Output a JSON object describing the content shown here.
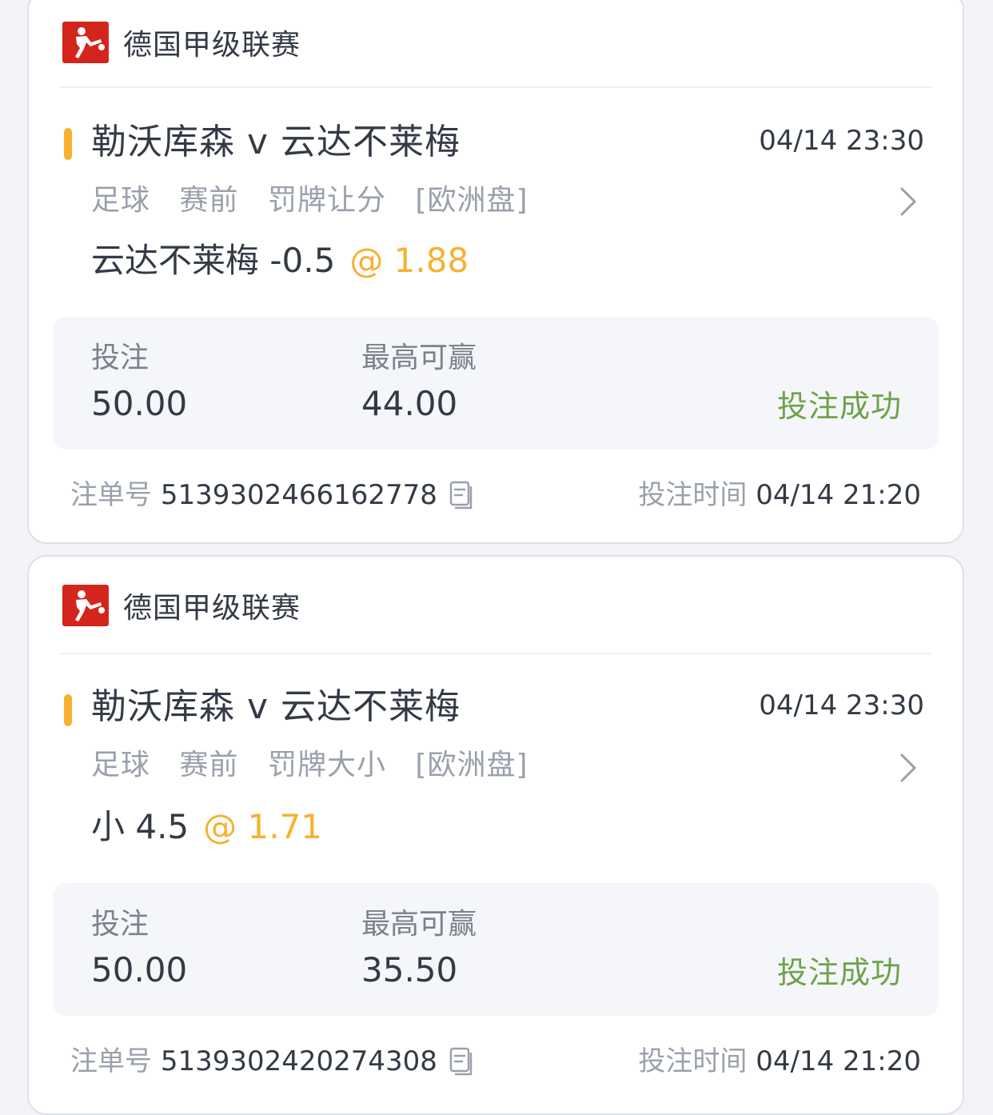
{
  "colors": {
    "accent": "#f6b12f",
    "success": "#6ea24a",
    "brand_red": "#d4251c"
  },
  "bets": [
    {
      "league": "德国甲级联赛",
      "match": "勒沃库森 v 云达不莱梅",
      "kickoff": "04/14 23:30",
      "sport": "足球",
      "phase": "赛前",
      "market": "罚牌让分",
      "odds_format": "[欧洲盘]",
      "selection": "云达不莱梅 -0.5",
      "odds": "@ 1.88",
      "stake_label": "投注",
      "stake": "50.00",
      "max_win_label": "最高可赢",
      "max_win": "44.00",
      "status": "投注成功",
      "ticket_label": "注单号",
      "ticket_no": "5139302466162778",
      "bet_time_label": "投注时间",
      "bet_time": "04/14 21:20"
    },
    {
      "league": "德国甲级联赛",
      "match": "勒沃库森 v 云达不莱梅",
      "kickoff": "04/14 23:30",
      "sport": "足球",
      "phase": "赛前",
      "market": "罚牌大小",
      "odds_format": "[欧洲盘]",
      "selection": "小 4.5",
      "odds": "@ 1.71",
      "stake_label": "投注",
      "stake": "50.00",
      "max_win_label": "最高可赢",
      "max_win": "35.50",
      "status": "投注成功",
      "ticket_label": "注单号",
      "ticket_no": "5139302420274308",
      "bet_time_label": "投注时间",
      "bet_time": "04/14 21:20"
    }
  ],
  "icons": [
    "bundesliga-logo-icon",
    "chevron-right-icon",
    "copy-icon"
  ]
}
